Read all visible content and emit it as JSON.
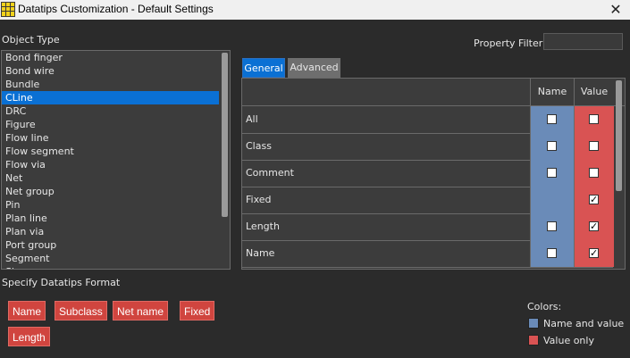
{
  "window": {
    "title": "Datatips Customization - Default Settings",
    "close_glyph": "✕"
  },
  "object_type": {
    "label": "Object Type",
    "items": [
      "Bond finger",
      "Bond wire",
      "Bundle",
      "CLine",
      "DRC",
      "Figure",
      "Flow line",
      "Flow segment",
      "Flow via",
      "Net",
      "Net group",
      "Pin",
      "Plan line",
      "Plan via",
      "Port group",
      "Segment",
      "Shape"
    ],
    "selected": "CLine"
  },
  "property_filter": {
    "label": "Property Filter",
    "value": ""
  },
  "tabs": {
    "general": "General",
    "advanced": "Advanced",
    "active": "General"
  },
  "grid": {
    "headers": {
      "name": "Name",
      "value": "Value"
    },
    "rows": [
      {
        "label": "All",
        "name_checked": false,
        "value_checked": false,
        "name_checkbox": true
      },
      {
        "label": "Class",
        "name_checked": false,
        "value_checked": false,
        "name_checkbox": true
      },
      {
        "label": "Comment",
        "name_checked": false,
        "value_checked": false,
        "name_checkbox": true
      },
      {
        "label": "Fixed",
        "name_checked": false,
        "value_checked": true,
        "name_checkbox": false
      },
      {
        "label": "Length",
        "name_checked": false,
        "value_checked": true,
        "name_checkbox": true
      },
      {
        "label": "Name",
        "name_checked": false,
        "value_checked": true,
        "name_checkbox": true
      }
    ]
  },
  "format": {
    "label": "Specify Datatips Format",
    "tags": [
      "Name",
      "Subclass",
      "Net name",
      "Fixed",
      "Length"
    ]
  },
  "legend": {
    "title": "Colors:",
    "name_and_value": {
      "label": "Name and value",
      "color": "#6a8bb8"
    },
    "value_only": {
      "label": "Value only",
      "color": "#d95353"
    }
  },
  "colors": {
    "accent": "#0a70d4",
    "tag": "#d0453f"
  }
}
